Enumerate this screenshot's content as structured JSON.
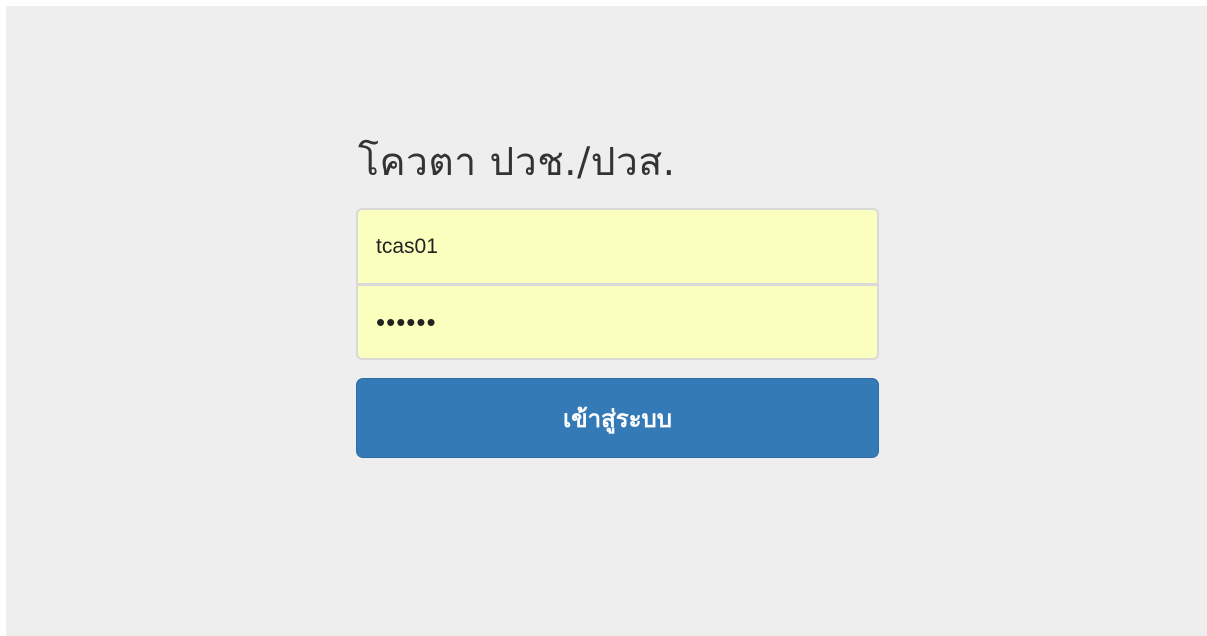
{
  "form": {
    "heading": "โควตา ปวช./ปวส.",
    "username": {
      "value": "tcas01"
    },
    "password": {
      "value": "••••••"
    },
    "submit_label": "เข้าสู่ระบบ"
  },
  "colors": {
    "page_background": "#eeeeee",
    "autofill_background": "#faffbd",
    "button_primary": "#337ab7",
    "heading_text": "#333333"
  }
}
